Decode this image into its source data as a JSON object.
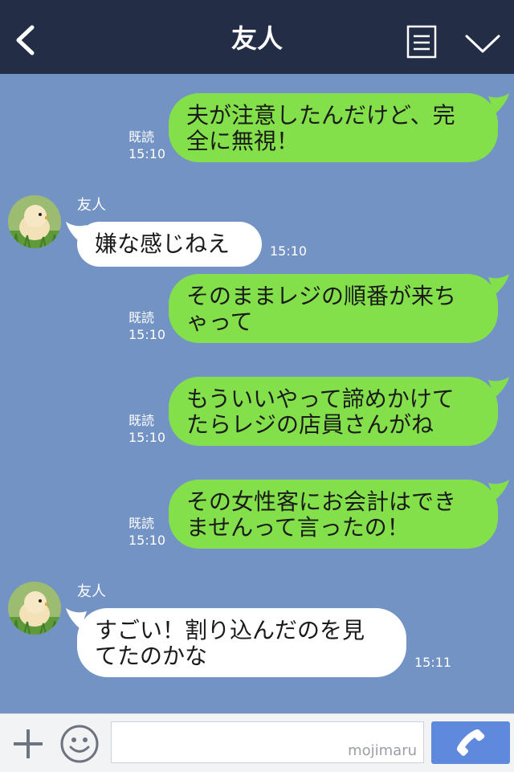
{
  "header": {
    "title": "友人",
    "back_icon": "chevron-left-icon",
    "notes_icon": "notes-icon",
    "menu_icon": "chevron-down-icon",
    "background": "#232d45"
  },
  "chat": {
    "background": "#7393c4",
    "sent_bubble_color": "#84e04a",
    "received_bubble_color": "#ffffff",
    "messages": [
      {
        "direction": "sent",
        "line1": "夫が注意したんだけど、完",
        "line2": "全に無視！",
        "read": "既読",
        "time": "15:10"
      },
      {
        "direction": "received",
        "sender": "友人",
        "line1": "嫌な感じねえ",
        "time": "15:10"
      },
      {
        "direction": "sent",
        "line1": "そのままレジの順番が来ち",
        "line2": "ゃって",
        "read": "既読",
        "time": "15:10"
      },
      {
        "direction": "sent",
        "line1": "もういいやって諦めかけて",
        "line2": "たらレジの店員さんがね",
        "read": "既読",
        "time": "15:10"
      },
      {
        "direction": "sent",
        "line1": "その女性客にお会計はでき",
        "line2": "ませんって言ったの！",
        "read": "既読",
        "time": "15:10"
      },
      {
        "direction": "received",
        "sender": "友人",
        "line1": "すごい！割り込んだのを見",
        "line2": "てたのかな",
        "time": "15:11"
      }
    ]
  },
  "bottom_bar": {
    "add_icon": "plus-icon",
    "sticker_icon": "smile-icon",
    "input_value": "",
    "watermark": "mojimaru",
    "call_icon": "phone-icon",
    "call_color": "#5e89dc"
  }
}
